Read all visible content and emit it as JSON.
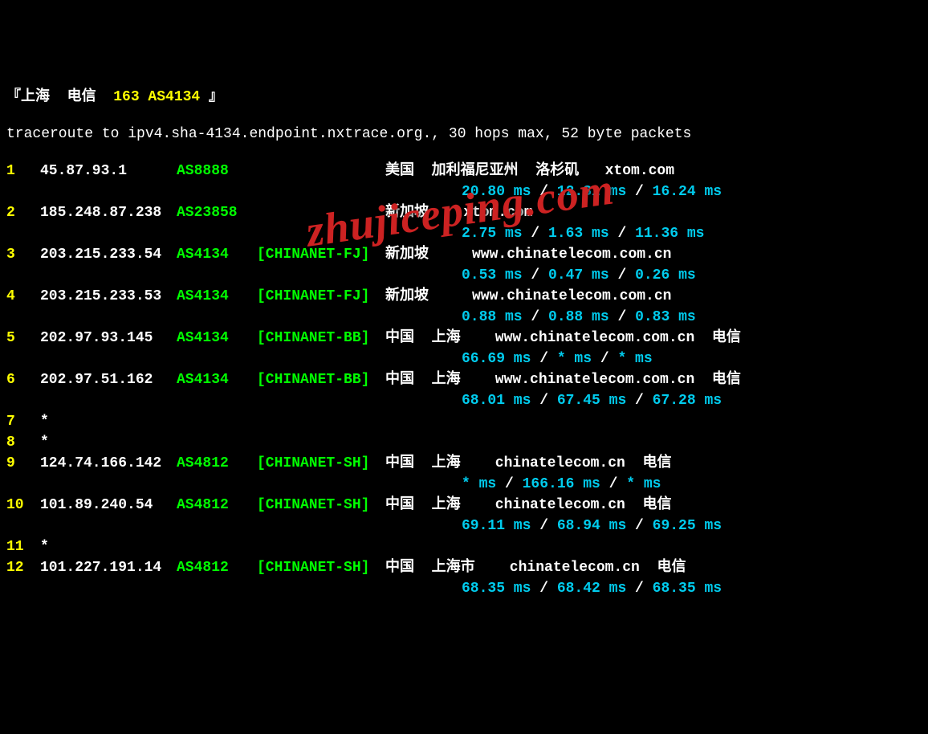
{
  "header": {
    "open": "『",
    "location": "上海  电信  ",
    "asn": "163 AS4134",
    "close": " 』"
  },
  "traceroute_line": "traceroute to ipv4.sha-4134.endpoint.nxtrace.org., 30 hops max, 52 byte packets",
  "watermark": "zhujiceping.com",
  "hops": [
    {
      "n": "1",
      "ip": "45.87.93.1",
      "asn": "AS8888",
      "tag": "",
      "loc": "美国  加利福尼亚州  洛杉矶   xtom.com",
      "t1": "20.80 ms",
      "t2": "12.31 ms",
      "t3": "16.24 ms"
    },
    {
      "n": "2",
      "ip": "185.248.87.238",
      "asn": "AS23858",
      "tag": "",
      "loc": "新加坡    xtom.com",
      "t1": "2.75 ms",
      "t2": "1.63 ms",
      "t3": "11.36 ms"
    },
    {
      "n": "3",
      "ip": "203.215.233.54",
      "asn": "AS4134",
      "tag": "[CHINANET-FJ]",
      "loc": "新加坡     www.chinatelecom.com.cn",
      "t1": "0.53 ms",
      "t2": "0.47 ms",
      "t3": "0.26 ms"
    },
    {
      "n": "4",
      "ip": "203.215.233.53",
      "asn": "AS4134",
      "tag": "[CHINANET-FJ]",
      "loc": "新加坡     www.chinatelecom.com.cn",
      "t1": "0.88 ms",
      "t2": "0.88 ms",
      "t3": "0.83 ms"
    },
    {
      "n": "5",
      "ip": "202.97.93.145",
      "asn": "AS4134",
      "tag": "[CHINANET-BB]",
      "loc": "中国  上海    www.chinatelecom.com.cn  电信",
      "t1": "66.69 ms",
      "t2": "* ms",
      "t3": "* ms"
    },
    {
      "n": "6",
      "ip": "202.97.51.162",
      "asn": "AS4134",
      "tag": "[CHINANET-BB]",
      "loc": "中国  上海    www.chinatelecom.com.cn  电信",
      "t1": "68.01 ms",
      "t2": "67.45 ms",
      "t3": "67.28 ms"
    },
    {
      "n": "7",
      "ip": "*",
      "asn": "",
      "tag": "",
      "loc": "",
      "t1": "",
      "t2": "",
      "t3": ""
    },
    {
      "n": "8",
      "ip": "*",
      "asn": "",
      "tag": "",
      "loc": "",
      "t1": "",
      "t2": "",
      "t3": ""
    },
    {
      "n": "9",
      "ip": "124.74.166.142",
      "asn": "AS4812",
      "tag": "[CHINANET-SH]",
      "loc": "中国  上海    chinatelecom.cn  电信",
      "t1": "* ms",
      "t2": "166.16 ms",
      "t3": "* ms"
    },
    {
      "n": "10",
      "ip": "101.89.240.54",
      "asn": "AS4812",
      "tag": "[CHINANET-SH]",
      "loc": "中国  上海    chinatelecom.cn  电信",
      "t1": "69.11 ms",
      "t2": "68.94 ms",
      "t3": "69.25 ms"
    },
    {
      "n": "11",
      "ip": "*",
      "asn": "",
      "tag": "",
      "loc": "",
      "t1": "",
      "t2": "",
      "t3": ""
    },
    {
      "n": "12",
      "ip": "101.227.191.14",
      "asn": "AS4812",
      "tag": "[CHINANET-SH]",
      "loc": "中国  上海市    chinatelecom.cn  电信",
      "t1": "68.35 ms",
      "t2": "68.42 ms",
      "t3": "68.35 ms"
    }
  ]
}
